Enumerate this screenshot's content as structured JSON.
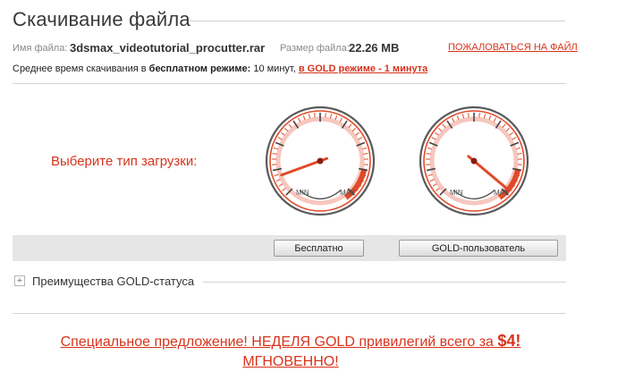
{
  "page": {
    "title": "Скачивание файла"
  },
  "file": {
    "name_label": "Имя файла:",
    "name": "3dsmax_videotutorial_procutter.rar",
    "size_label": "Размер файла:",
    "size": "22.26 MB",
    "report_link": "ПОЖАЛОВАТЬСЯ НА ФАЙЛ"
  },
  "avg_time": {
    "prefix": "Среднее время скачивания в ",
    "free_mode": "бесплатном режиме:",
    "free_time": " 10 минут, ",
    "gold_link": "в GOLD режиме - 1 минута"
  },
  "download": {
    "choose_label": "Выберите тип загрузки:",
    "gauges": [
      {
        "min_label": "MIN",
        "max_label": "MAX"
      },
      {
        "min_label": "MIN",
        "max_label": "MAX"
      }
    ],
    "buttons": {
      "free": "Бесплатно",
      "gold": "GOLD-пользователь"
    }
  },
  "benefits": {
    "toggle": "+",
    "label": "Преимущества GOLD-статуса"
  },
  "offer": {
    "line1": "Специальное предложение! НЕДЕЛЯ GOLD привилегий всего за ",
    "price": "$4!",
    "line2": "МГНОВЕННО!"
  },
  "colors": {
    "accent": "#d8331c",
    "gauge_red": "#e04a2a"
  }
}
